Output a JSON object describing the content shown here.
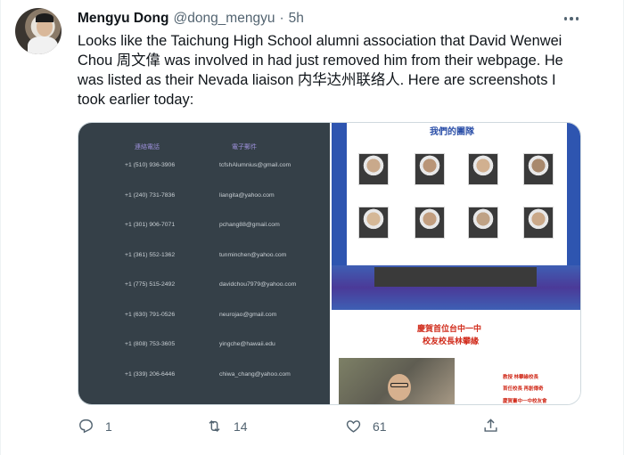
{
  "tweet": {
    "author_name": "Mengyu Dong",
    "author_handle": "@dong_mengyu",
    "separator": "·",
    "time": "5h",
    "text_lines": [
      "Looks like the Taichung High School alumni association that David Wenwei",
      "Chou 周文偉 was involved in had just removed him from their webpage. He",
      "was listed as their Nevada liaison 内华达州联络人. Here are screenshots I",
      "took earlier today:"
    ]
  },
  "screenshot_left": {
    "phone_header": "連絡電話",
    "email_header": "電子郵件",
    "rows": [
      {
        "phone": "+1 (510) 936-3906",
        "email": "tcfshAlumnius@gmail.com"
      },
      {
        "phone": "+1 (240) 731-7836",
        "email": "liangita@yahoo.com"
      },
      {
        "phone": "+1 (301) 906-7071",
        "email": "pchang88@gmail.com"
      },
      {
        "phone": "+1 (361) 552-1362",
        "email": "tunminchen@yahoo.com"
      },
      {
        "phone": "+1 (775) 515-2492",
        "email": "davidchou7979@yahoo.com"
      },
      {
        "phone": "+1 (630) 791-0526",
        "email": "neurojao@gmail.com"
      },
      {
        "phone": "+1 (808) 753-3605",
        "email": "yingche@hawaii.edu"
      },
      {
        "phone": "+1 (339) 206-6446",
        "email": "chiwa_chang@yahoo.com"
      }
    ]
  },
  "screenshot_right": {
    "team_title": "我們的團隊",
    "congrats_line1": "慶賀首位台中一中",
    "congrats_line2": "校友校長林攀緣",
    "red_lines": [
      "教授 林攀緣校長",
      "首任校長 再創傳奇",
      "慶賀臺中一中校友會"
    ]
  },
  "actions": {
    "reply_count": "1",
    "retweet_count": "14",
    "like_count": "61"
  }
}
